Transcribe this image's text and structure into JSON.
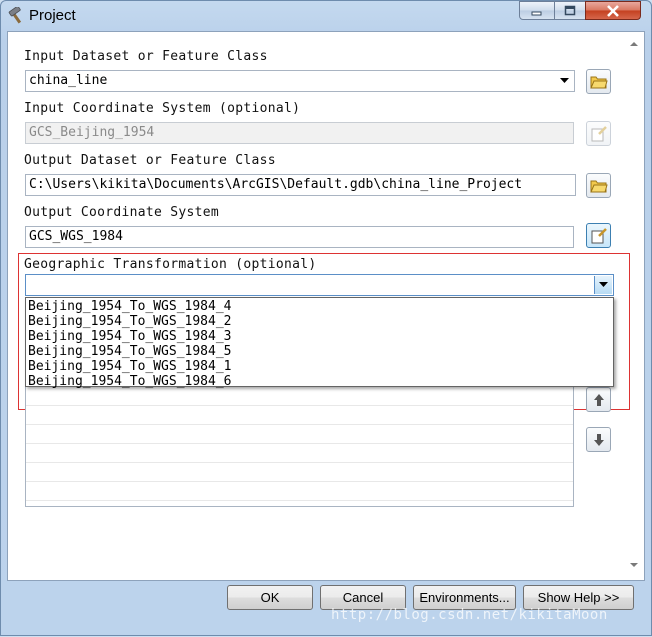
{
  "window": {
    "title": "Project",
    "colors": {
      "frame": "#bcd3ec",
      "close_button": "#c4401f",
      "highlight_box": "#dd3333"
    }
  },
  "form": {
    "input_dataset": {
      "label": "Input Dataset or Feature Class",
      "value": "china_line"
    },
    "input_coord": {
      "label": "Input Coordinate System (optional)",
      "value": "GCS_Beijing_1954"
    },
    "output_dataset": {
      "label": "Output Dataset or Feature Class",
      "value": "C:\\Users\\kikita\\Documents\\ArcGIS\\Default.gdb\\china_line_Project"
    },
    "output_coord": {
      "label": "Output Coordinate System",
      "value": "GCS_WGS_1984"
    },
    "geo_transform": {
      "label": "Geographic Transformation (optional)",
      "value": "",
      "options": [
        "Beijing_1954_To_WGS_1984_4",
        "Beijing_1954_To_WGS_1984_2",
        "Beijing_1954_To_WGS_1984_3",
        "Beijing_1954_To_WGS_1984_5",
        "Beijing_1954_To_WGS_1984_1",
        "Beijing_1954_To_WGS_1984_6"
      ]
    }
  },
  "buttons": {
    "ok": "OK",
    "cancel": "Cancel",
    "environments": "Environments...",
    "show_help": "Show Help >>"
  },
  "watermark": "http://blog.csdn.net/kikitaMoon"
}
